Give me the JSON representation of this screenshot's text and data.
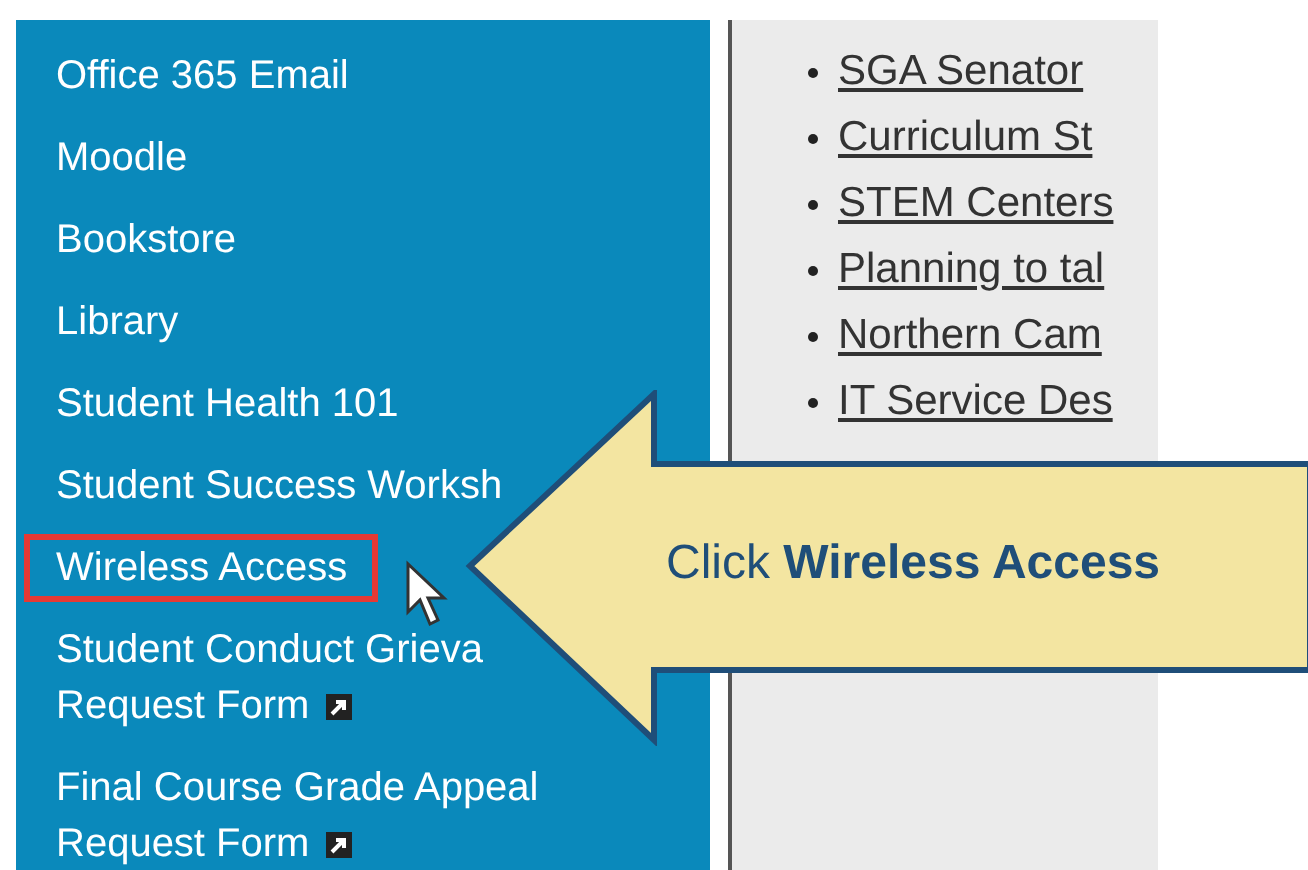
{
  "sidebar": {
    "items": [
      {
        "lines": [
          "Office 365 Email"
        ],
        "external": false,
        "selected": false
      },
      {
        "lines": [
          "Moodle"
        ],
        "external": false,
        "selected": false
      },
      {
        "lines": [
          "Bookstore"
        ],
        "external": false,
        "selected": false
      },
      {
        "lines": [
          "Library"
        ],
        "external": false,
        "selected": false
      },
      {
        "lines": [
          "Student Health 101"
        ],
        "external": false,
        "selected": false
      },
      {
        "lines": [
          "Student Success Worksh"
        ],
        "external": false,
        "selected": false
      },
      {
        "lines": [
          "Wireless Access"
        ],
        "external": false,
        "selected": true
      },
      {
        "lines": [
          "Student Conduct Grieva",
          "Request Form"
        ],
        "external": true,
        "selected": false
      },
      {
        "lines": [
          "Final Course Grade Appeal",
          "Request Form"
        ],
        "external": true,
        "selected": false
      }
    ]
  },
  "news": {
    "links": [
      "SGA Senator",
      "Curriculum St",
      "STEM Centers",
      "Planning to tal",
      "Northern Cam",
      "IT Service Des"
    ]
  },
  "callout": {
    "text": "Click **Wireless Access**"
  }
}
